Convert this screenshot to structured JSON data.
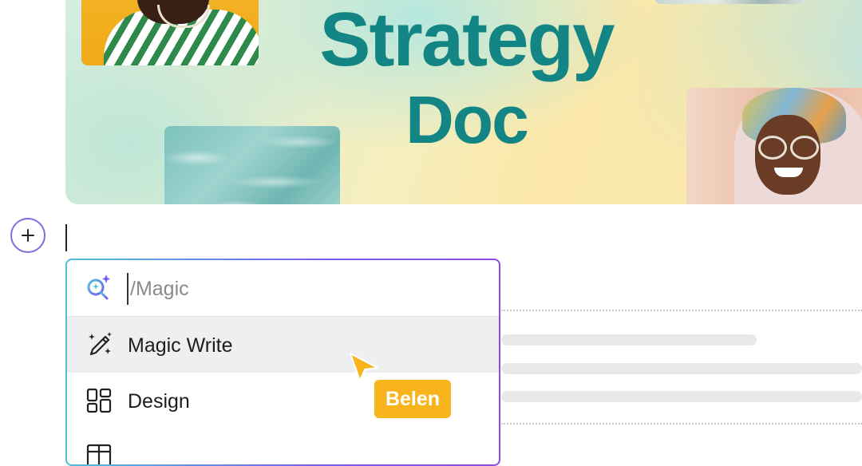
{
  "banner": {
    "title_line1": "Strategy",
    "title_line2": "Doc"
  },
  "editor": {
    "add_block_icon": "plus-icon"
  },
  "command_menu": {
    "search_placeholder": "/Magic",
    "search_icon": "magic-search-icon",
    "items": [
      {
        "label": "Magic Write",
        "icon": "magic-pen-icon",
        "highlighted": true
      },
      {
        "label": "Design",
        "icon": "grid-icon",
        "highlighted": false
      },
      {
        "label": "",
        "icon": "table-icon",
        "highlighted": false
      }
    ]
  },
  "collaborator": {
    "name": "Belen",
    "color": "#f8b41c"
  },
  "colors": {
    "title_teal": "#138584",
    "accent_purple": "#7b5cf0",
    "accent_cyan": "#4fc1d8"
  }
}
